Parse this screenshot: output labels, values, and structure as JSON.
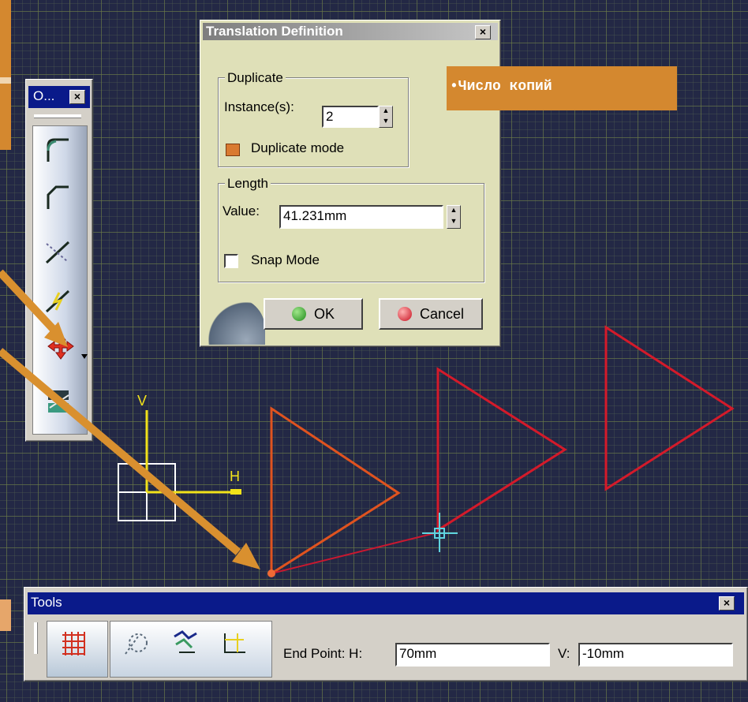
{
  "translation_dialog": {
    "title": "Translation Definition",
    "duplicate_group": "Duplicate",
    "instances_label": "Instance(s):",
    "instances_value": "2",
    "duplicate_mode_label": "Duplicate mode",
    "length_group": "Length",
    "value_label": "Value:",
    "value_value": "41.231mm",
    "snap_mode_label": "Snap Mode",
    "ok_label": "OK",
    "cancel_label": "Cancel"
  },
  "callout": {
    "text": "•Число копий"
  },
  "operations_toolbar": {
    "title": "O...",
    "tools": [
      "corner-icon",
      "chamfer-icon",
      "trim-icon",
      "break-icon",
      "translate-icon",
      "offset-icon"
    ]
  },
  "tools_toolbar": {
    "title": "Tools",
    "end_point_label": "End Point: H:",
    "h_value": "70mm",
    "v_label": "V:",
    "v_value": "-10mm"
  },
  "canvas": {
    "axis_v_label": "V",
    "axis_h_label": "H"
  },
  "colors": {
    "callout_bg": "#d4882f",
    "dialog_bg": "#dfe0b8",
    "triangle_original": "#e0531f",
    "triangle_copies": "#d41a2a",
    "grid_bg": "#232845",
    "tools_titlebar": "#0a1a8a"
  }
}
